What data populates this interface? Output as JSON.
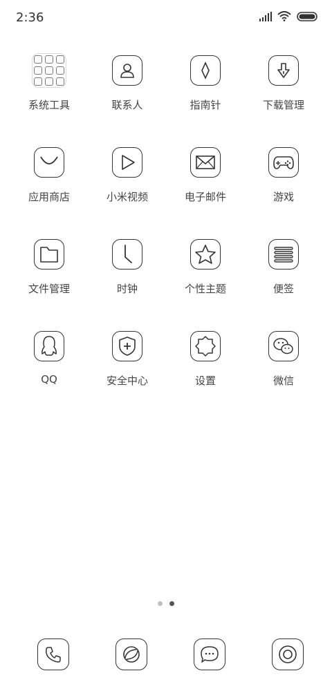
{
  "status": {
    "time": "2:36"
  },
  "apps": [
    {
      "label": "系统工具",
      "icon": "folder-icon"
    },
    {
      "label": "联系人",
      "icon": "contacts-icon"
    },
    {
      "label": "指南针",
      "icon": "compass-icon"
    },
    {
      "label": "下载管理",
      "icon": "download-icon"
    },
    {
      "label": "应用商店",
      "icon": "app-store-icon"
    },
    {
      "label": "小米视频",
      "icon": "video-play-icon"
    },
    {
      "label": "电子邮件",
      "icon": "mail-icon"
    },
    {
      "label": "游戏",
      "icon": "gamepad-icon"
    },
    {
      "label": "文件管理",
      "icon": "file-manager-icon"
    },
    {
      "label": "时钟",
      "icon": "clock-icon"
    },
    {
      "label": "个性主题",
      "icon": "star-theme-icon"
    },
    {
      "label": "便签",
      "icon": "notes-icon"
    },
    {
      "label": "QQ",
      "icon": "qq-penguin-icon"
    },
    {
      "label": "安全中心",
      "icon": "security-shield-icon"
    },
    {
      "label": "设置",
      "icon": "settings-icon"
    },
    {
      "label": "微信",
      "icon": "wechat-icon"
    }
  ],
  "pager": {
    "pages": 2,
    "active": 2
  },
  "dock": [
    {
      "icon": "phone-icon"
    },
    {
      "icon": "browser-icon"
    },
    {
      "icon": "messages-icon"
    },
    {
      "icon": "camera-icon"
    }
  ]
}
